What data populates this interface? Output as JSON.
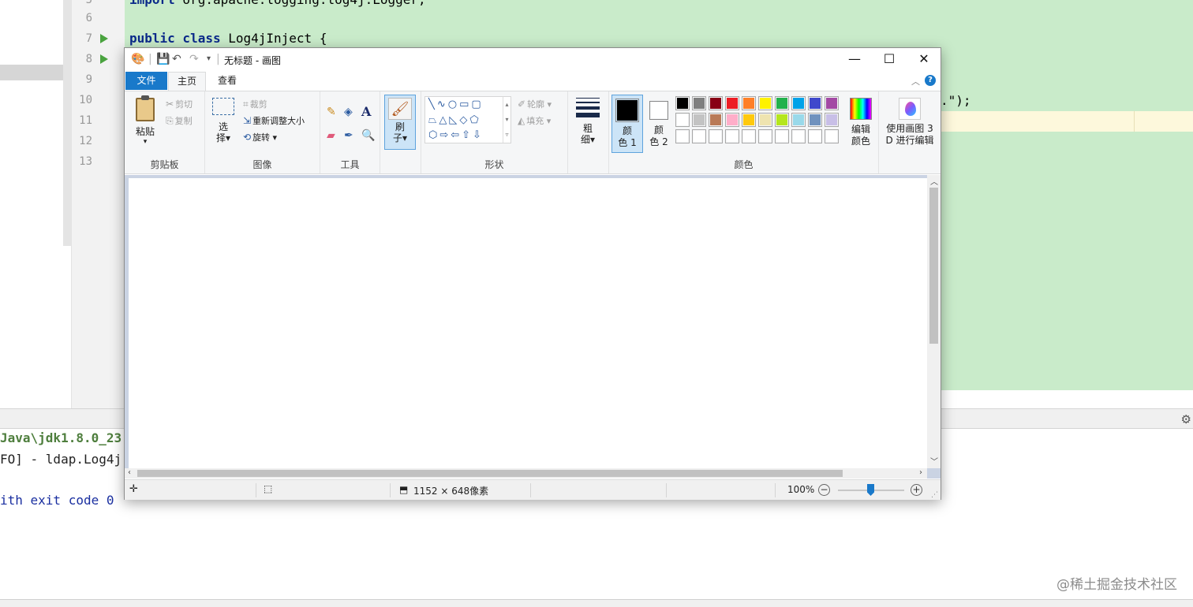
{
  "ide": {
    "line_numbers": [
      "5",
      "6",
      "7",
      "8",
      "9",
      "10",
      "11",
      "12",
      "13"
    ],
    "code": {
      "import_kw": "import",
      "import_rest": " org.apache.logging.log4j.Logger;",
      "class_kw": "public class",
      "class_rest": " Log4jInject {",
      "string_tail": ".\");"
    },
    "console": {
      "line1": "Java\\jdk1.8.0_23",
      "line2": "FO] - ldap.Log4j",
      "line3": "ith exit code 0"
    },
    "watermark": "@稀土掘金技术社区"
  },
  "paint": {
    "title": "无标题 - 画图",
    "tabs": {
      "file": "文件",
      "home": "主页",
      "view": "查看"
    },
    "clipboard": {
      "paste": "粘贴",
      "cut": "剪切",
      "copy": "复制",
      "label": "剪贴板"
    },
    "image": {
      "select_1": "选",
      "select_2": "择",
      "crop": "裁剪",
      "resize": "重新调整大小",
      "rotate": "旋转",
      "label": "图像"
    },
    "tools": {
      "label": "工具"
    },
    "brush": {
      "line1": "刷",
      "line2": "子"
    },
    "shapes": {
      "outline": "轮廓",
      "fill": "填充",
      "label": "形状"
    },
    "size": {
      "line1": "粗",
      "line2": "细"
    },
    "colors": {
      "color1_line1": "颜",
      "color1_line2": "色 1",
      "color2_line1": "颜",
      "color2_line2": "色 2",
      "edit_line1": "编辑",
      "edit_line2": "颜色",
      "label": "颜色",
      "color1": "#000000",
      "color2": "#ffffff",
      "palette_row1": [
        "#000000",
        "#7f7f7f",
        "#880015",
        "#ed1c24",
        "#ff7f27",
        "#fff200",
        "#22b14c",
        "#00a2e8",
        "#3f48cc",
        "#a349a4"
      ],
      "palette_row2": [
        "#ffffff",
        "#c3c3c3",
        "#b97a57",
        "#ffaec9",
        "#ffc90e",
        "#efe4b0",
        "#b5e61d",
        "#99d9ea",
        "#7092be",
        "#c8bfe7"
      ],
      "palette_row3": [
        "#ffffff",
        "#ffffff",
        "#ffffff",
        "#ffffff",
        "#ffffff",
        "#ffffff",
        "#ffffff",
        "#ffffff",
        "#ffffff",
        "#ffffff"
      ]
    },
    "paint3d": {
      "line1": "使用画图 3",
      "line2": "D 进行编辑"
    },
    "status": {
      "dimensions": "1152 × 648像素",
      "zoom": "100%"
    }
  }
}
